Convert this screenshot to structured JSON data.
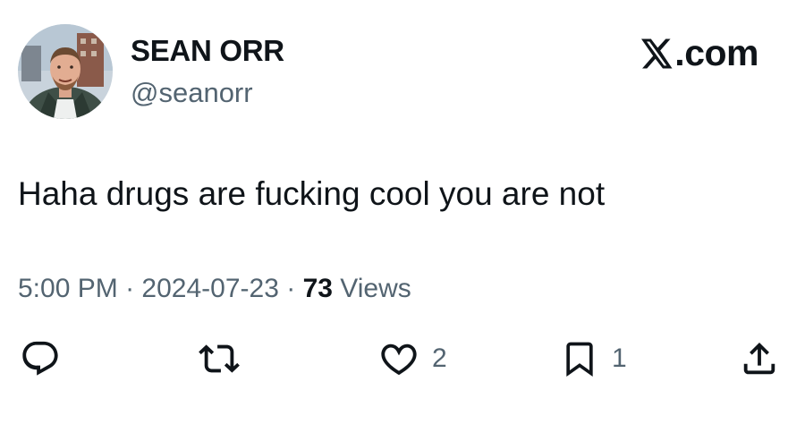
{
  "author": {
    "display_name": "SEAN ORR",
    "handle": "@seanorr",
    "avatar_icon": "profile-photo"
  },
  "brand": {
    "label": ".com",
    "logo_icon": "x-logo-icon"
  },
  "tweet": {
    "text": "Haha drugs are fucking cool you are not"
  },
  "meta": {
    "time": "5:00 PM",
    "separator": "·",
    "date": "2024-07-23",
    "views_count": "73",
    "views_label": "Views"
  },
  "actions": {
    "reply": {
      "icon": "reply-icon",
      "count": ""
    },
    "retweet": {
      "icon": "retweet-icon",
      "count": ""
    },
    "like": {
      "icon": "heart-icon",
      "count": "2"
    },
    "bookmark": {
      "icon": "bookmark-icon",
      "count": "1"
    },
    "share": {
      "icon": "share-icon",
      "count": ""
    }
  },
  "colors": {
    "text_primary": "#0f1419",
    "text_secondary": "#536471",
    "background": "#ffffff"
  }
}
